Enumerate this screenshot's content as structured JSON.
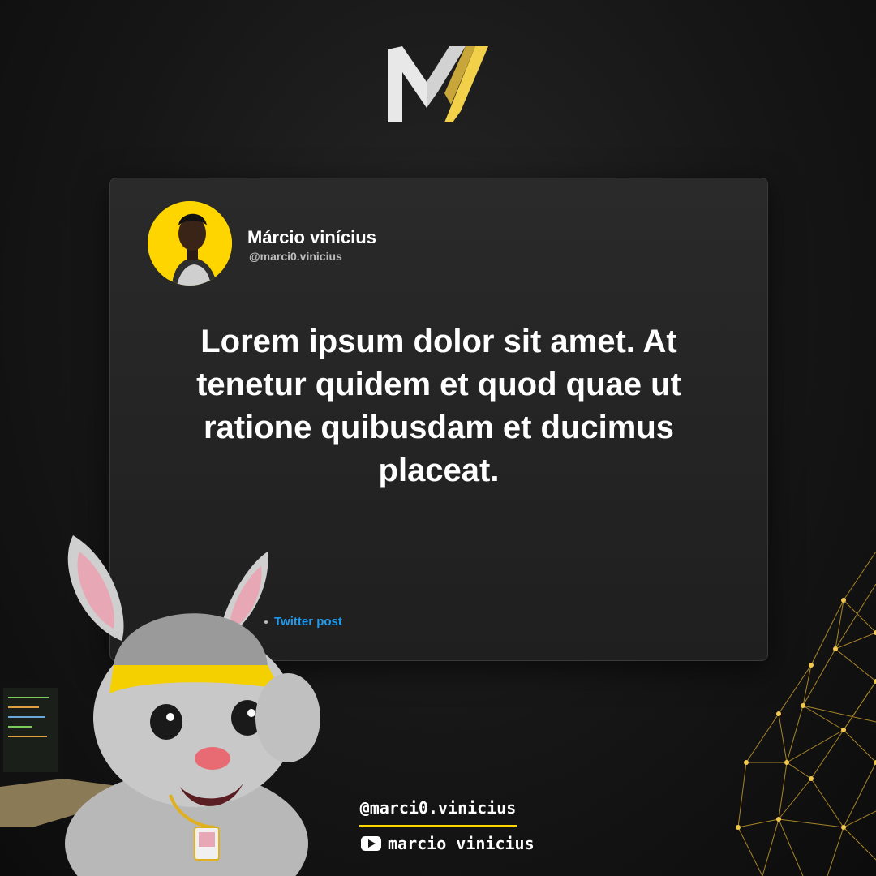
{
  "brand": {
    "logo_icon": "m-v-monogram-logo",
    "accent_color": "#ffd500"
  },
  "post": {
    "author_name": "Márcio vinícius",
    "author_handle": "@marci0.vinicius",
    "avatar_icon": "profile-photo-avatar",
    "text": "Lorem ipsum dolor sit amet. At tenetur quidem et quod quae ut ratione quibusdam et ducimus placeat.",
    "link_label": "Twitter post",
    "link_color": "#1d9bf0"
  },
  "footer": {
    "handle": "@marci0.vinicius",
    "youtube_icon": "youtube-icon",
    "youtube_name": "marcio vinicius"
  }
}
